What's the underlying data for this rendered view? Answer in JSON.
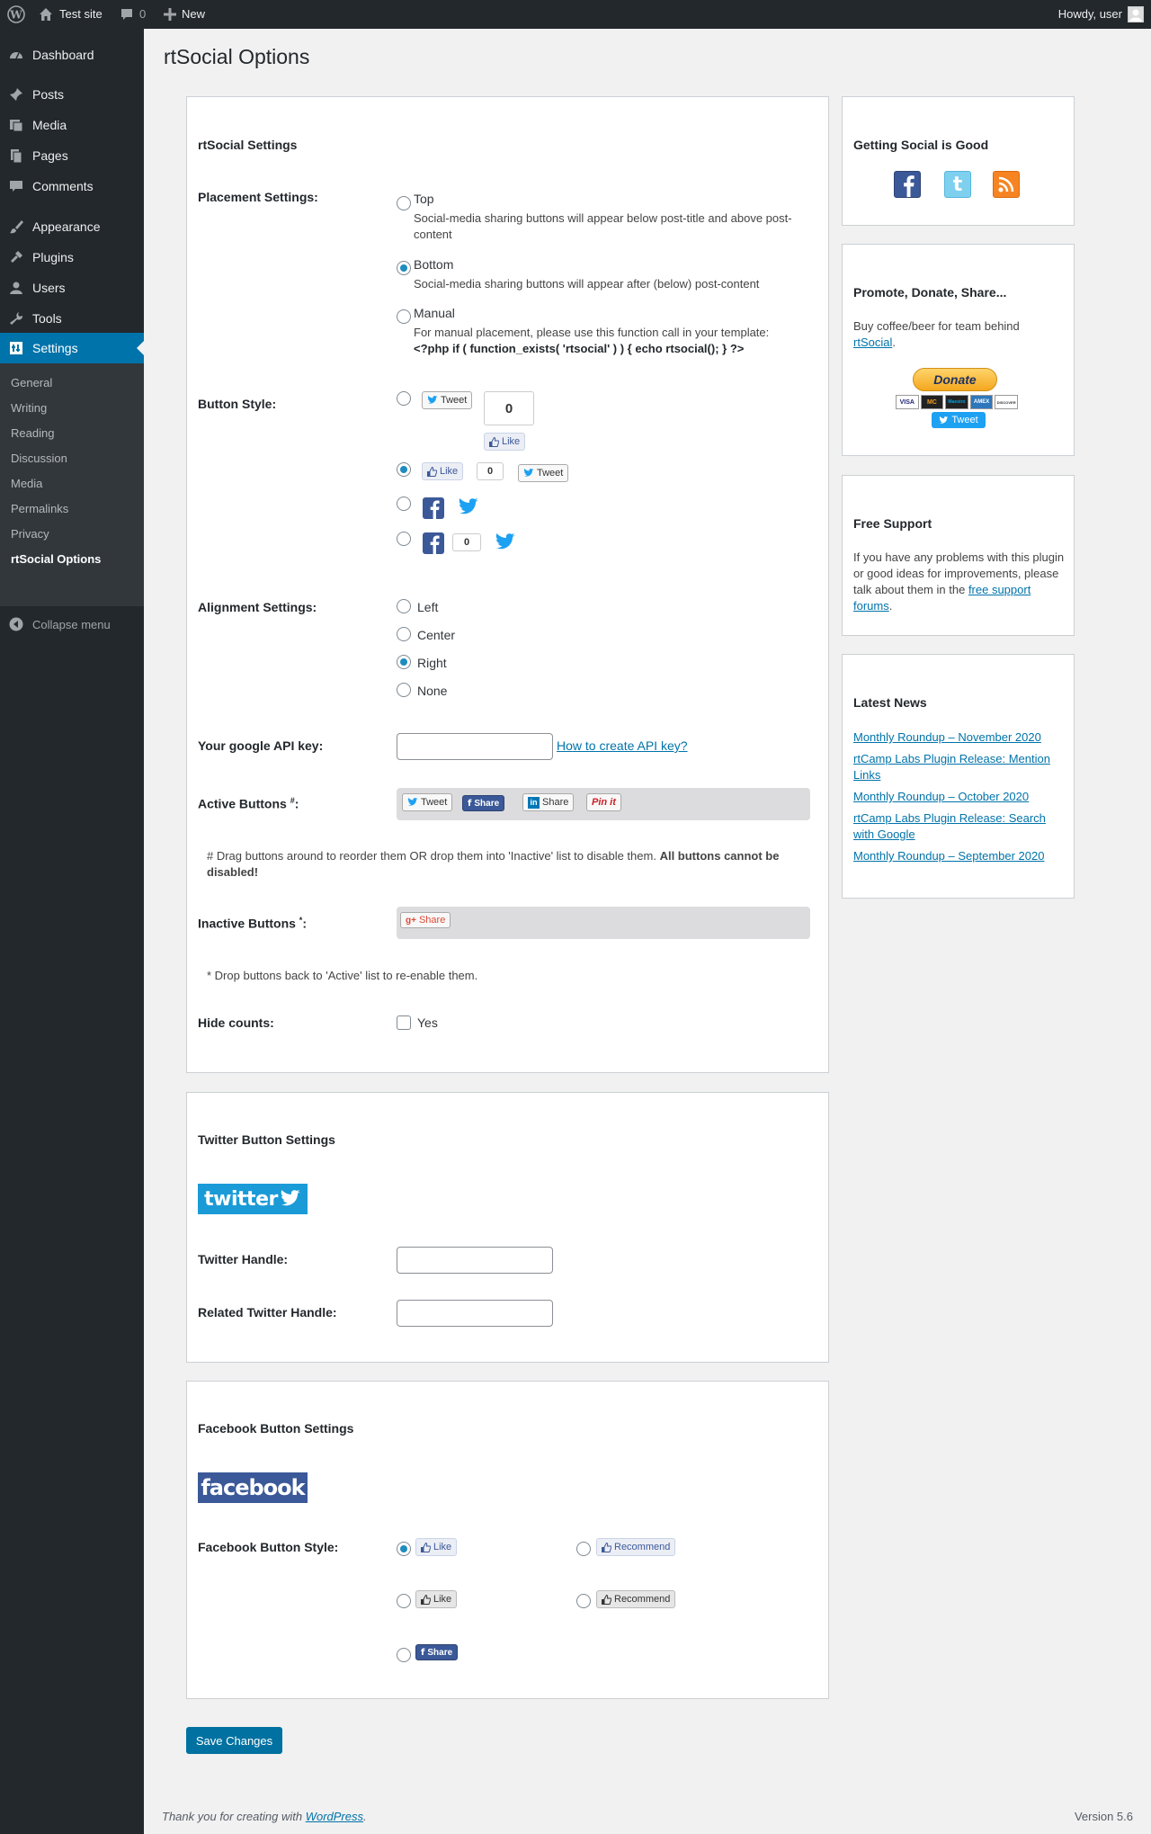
{
  "admin_bar": {
    "site_name": "Test site",
    "comments_count": "0",
    "new_label": "New",
    "greeting": "Howdy, user"
  },
  "sidebar": {
    "items": [
      {
        "label": "Dashboard",
        "icon": "dashboard-icon"
      },
      {
        "label": "Posts",
        "icon": "pin-icon"
      },
      {
        "label": "Media",
        "icon": "media-icon"
      },
      {
        "label": "Pages",
        "icon": "pages-icon"
      },
      {
        "label": "Comments",
        "icon": "comment-icon"
      },
      {
        "label": "Appearance",
        "icon": "brush-icon"
      },
      {
        "label": "Plugins",
        "icon": "plug-icon"
      },
      {
        "label": "Users",
        "icon": "user-icon"
      },
      {
        "label": "Tools",
        "icon": "wrench-icon"
      },
      {
        "label": "Settings",
        "icon": "settings-icon"
      }
    ],
    "submenu": [
      "General",
      "Writing",
      "Reading",
      "Discussion",
      "Media",
      "Permalinks",
      "Privacy",
      "rtSocial Options"
    ],
    "collapse_label": "Collapse menu"
  },
  "page": {
    "title": "rtSocial Options"
  },
  "settings": {
    "box_title": "rtSocial Settings",
    "placement": {
      "label": "Placement Settings:",
      "options": [
        {
          "label": "Top",
          "desc": "Social-media sharing buttons will appear below post-title and above post-",
          "desc2": "content"
        },
        {
          "label": "Bottom",
          "desc": "Social-media sharing buttons will appear after (below) post-content"
        },
        {
          "label": "Manual",
          "desc": "For manual placement, please use this function call in your template:",
          "code": "<?php if ( function_exists( 'rtsocial' ) ) { echo rtsocial(); } ?>"
        }
      ],
      "selected": "Bottom"
    },
    "button_style": {
      "label": "Button Style:",
      "tweet": "Tweet",
      "like": "Like",
      "count": "0"
    },
    "alignment": {
      "label": "Alignment Settings:",
      "options": [
        "Left",
        "Center",
        "Right",
        "None"
      ],
      "selected": "Right"
    },
    "api_key": {
      "label": "Your google API key:",
      "value": "",
      "link": "How to create API key?"
    },
    "active_buttons": {
      "label": "Active Buttons",
      "marker": "#",
      "buttons": [
        "Tweet",
        "Share",
        "Share",
        "Pin it"
      ]
    },
    "drag_note": "# Drag buttons around to reorder them OR drop them into 'Inactive' list to disable them.",
    "drag_note_bold": "All buttons cannot be",
    "drag_note_bold2": "disabled!",
    "inactive_buttons": {
      "label": "Inactive Buttons",
      "marker": "*",
      "buttons": [
        "Share"
      ]
    },
    "reenable_note": "* Drop buttons back to 'Active' list to re-enable them.",
    "hide_counts": {
      "label": "Hide counts:",
      "option": "Yes",
      "checked": false
    }
  },
  "twitter": {
    "box_title": "Twitter Button Settings",
    "logo_text": "twitter",
    "handle_label": "Twitter Handle:",
    "handle_value": "",
    "related_label": "Related Twitter Handle:",
    "related_value": ""
  },
  "facebook": {
    "box_title": "Facebook Button Settings",
    "logo_text": "facebook",
    "style_label": "Facebook Button Style:",
    "options": [
      "Like",
      "Recommend",
      "Like",
      "Recommend",
      "Share"
    ],
    "selected_index": 0
  },
  "save_button": "Save Changes",
  "side": {
    "social": {
      "title": "Getting Social is Good"
    },
    "donate": {
      "title": "Promote, Donate, Share...",
      "text": "Buy coffee/beer for team behind",
      "link": "rtSocial",
      "after_link": ".",
      "donate_label": "Donate",
      "tweet_label": "Tweet",
      "cards": [
        "VISA",
        "MC",
        "Maestro",
        "AMEX",
        "DISCOVER"
      ]
    },
    "support": {
      "title": "Free Support",
      "text": "If you have any problems with this plugin or good ideas for improvements, please talk about them in the",
      "link": "free support forums",
      "after_link": "."
    },
    "news": {
      "title": "Latest News",
      "items": [
        "Monthly Roundup – November 2020",
        "rtCamp Labs Plugin Release: Mention Links",
        "Monthly Roundup – October 2020",
        "rtCamp Labs Plugin Release: Search with Google",
        "Monthly Roundup – September 2020"
      ]
    }
  },
  "footer": {
    "thanks": "Thank you for creating with",
    "wp_link": "WordPress",
    "period": ".",
    "version": "Version 5.6"
  },
  "colors": {
    "accent": "#0073aa",
    "sidebar": "#23282d",
    "twitter": "#1da1f2",
    "facebook": "#3b5998"
  }
}
